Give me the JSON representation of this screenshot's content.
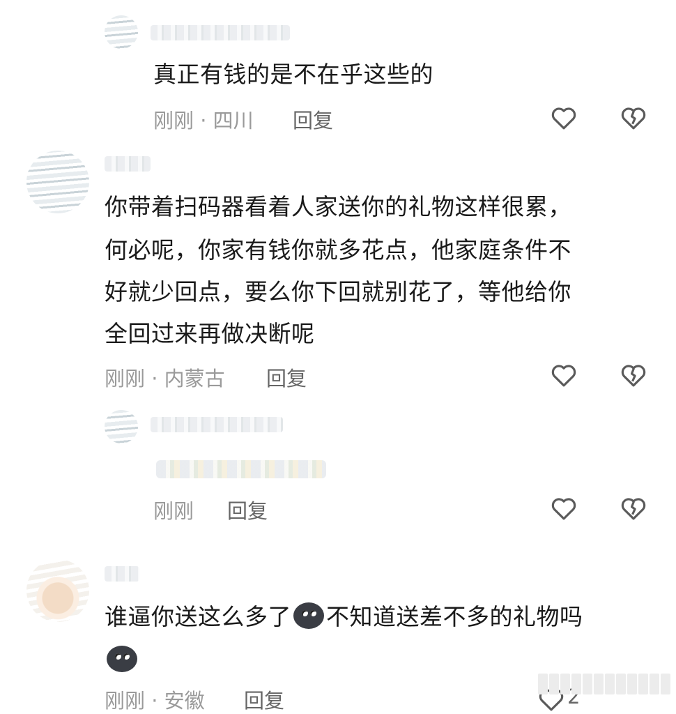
{
  "comments": [
    {
      "text": "真正有钱的是不在乎这些的",
      "time": "刚刚",
      "location": "· 四川",
      "reply_label": "回复",
      "like_icon": "heart-outline-icon",
      "dislike_icon": "broken-heart-icon"
    },
    {
      "text_lines": [
        "你带着扫码器看着人家送你的礼物这样很累，",
        "何必呢，你家有钱你就多花点，他家庭条件不",
        "好就少回点，要么你下回就别花了，等他给你",
        "全回过来再做决断呢"
      ],
      "time": "刚刚",
      "location": "· 内蒙古",
      "reply_label": "回复"
    },
    {
      "time": "刚刚",
      "reply_label": "回复"
    },
    {
      "text_part1": "谁逼你送这么多了",
      "text_part2": "不知道送差不多的礼物吗",
      "time": "刚刚",
      "location": "· 安徽",
      "reply_label": "回复",
      "like_count": "2"
    }
  ]
}
